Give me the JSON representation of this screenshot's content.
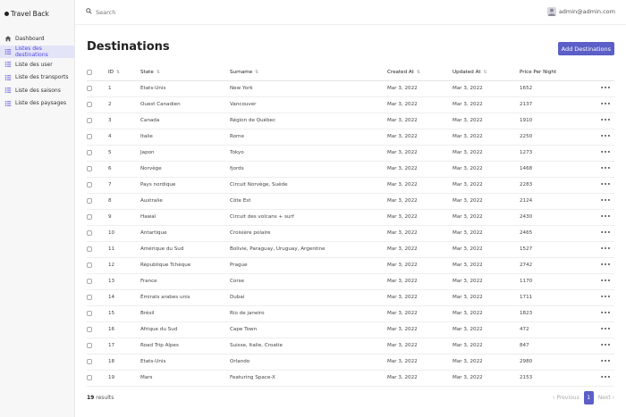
{
  "app": {
    "title": "Travel Back"
  },
  "sidebar": {
    "items": [
      {
        "label": "Dashboard",
        "icon": "home-icon",
        "active": false
      },
      {
        "label": "Listes des destinations",
        "icon": "list-icon",
        "active": true
      },
      {
        "label": "Liste des user",
        "icon": "list-icon",
        "active": false
      },
      {
        "label": "Liste des transports",
        "icon": "list-icon",
        "active": false
      },
      {
        "label": "Liste des saisons",
        "icon": "list-icon",
        "active": false
      },
      {
        "label": "Liste des paysages",
        "icon": "list-icon",
        "active": false
      }
    ]
  },
  "topbar": {
    "search_placeholder": "Search",
    "user_email": "admin@admin.com"
  },
  "page": {
    "title": "Destinations",
    "add_button": "Add Destinations"
  },
  "table": {
    "columns": [
      "ID",
      "State",
      "Surname",
      "Created At",
      "Updated At",
      "Price Per Night"
    ],
    "rows": [
      [
        "1",
        "Etats-Unis",
        "New York",
        "Mar 3, 2022",
        "Mar 3, 2022",
        "1652"
      ],
      [
        "2",
        "Ouest Canadien",
        "Vancouver",
        "Mar 3, 2022",
        "Mar 3, 2022",
        "2137"
      ],
      [
        "3",
        "Canada",
        "Région de Québec",
        "Mar 3, 2022",
        "Mar 3, 2022",
        "1910"
      ],
      [
        "4",
        "Italie",
        "Rome",
        "Mar 3, 2022",
        "Mar 3, 2022",
        "2250"
      ],
      [
        "5",
        "Japon",
        "Tokyo",
        "Mar 3, 2022",
        "Mar 3, 2022",
        "1273"
      ],
      [
        "6",
        "Norvège",
        "fjords",
        "Mar 3, 2022",
        "Mar 3, 2022",
        "1468"
      ],
      [
        "7",
        "Pays nordique",
        "Circuit Norvège, Suède",
        "Mar 3, 2022",
        "Mar 3, 2022",
        "2283"
      ],
      [
        "8",
        "Australie",
        "Côte Est",
        "Mar 3, 2022",
        "Mar 3, 2022",
        "2124"
      ],
      [
        "9",
        "Hawaï",
        "Circuit des volcans + surf",
        "Mar 3, 2022",
        "Mar 3, 2022",
        "2430"
      ],
      [
        "10",
        "Antartique",
        "Croisière polaire",
        "Mar 3, 2022",
        "Mar 3, 2022",
        "2465"
      ],
      [
        "11",
        "Amérique du Sud",
        "Bolivie, Paraguay, Uruguay, Argentine",
        "Mar 3, 2022",
        "Mar 3, 2022",
        "1527"
      ],
      [
        "12",
        "République Tchèque",
        "Prague",
        "Mar 3, 2022",
        "Mar 3, 2022",
        "2742"
      ],
      [
        "13",
        "France",
        "Corse",
        "Mar 3, 2022",
        "Mar 3, 2022",
        "1170"
      ],
      [
        "14",
        "Émirats arabes unis",
        "Dubai",
        "Mar 3, 2022",
        "Mar 3, 2022",
        "1711"
      ],
      [
        "15",
        "Brésil",
        "Rio de janeiro",
        "Mar 3, 2022",
        "Mar 3, 2022",
        "1823"
      ],
      [
        "16",
        "Afrique du Sud",
        "Cape Town",
        "Mar 3, 2022",
        "Mar 3, 2022",
        "472"
      ],
      [
        "17",
        "Road Trip Alpes",
        "Suisse, Italie, Croatie",
        "Mar 3, 2022",
        "Mar 3, 2022",
        "847"
      ],
      [
        "18",
        "Etats-Unis",
        "Orlando",
        "Mar 3, 2022",
        "Mar 3, 2022",
        "2980"
      ],
      [
        "19",
        "Mars",
        "Featuring Space-X",
        "Mar 3, 2022",
        "Mar 3, 2022",
        "2153"
      ]
    ],
    "row_action": "•••"
  },
  "footer": {
    "count": "19",
    "count_label": "results",
    "prev": "‹ Previous",
    "page": "1",
    "next": "Next ›"
  },
  "colors": {
    "accent": "#5b5fc7",
    "active_bg": "#e3e4f7"
  }
}
